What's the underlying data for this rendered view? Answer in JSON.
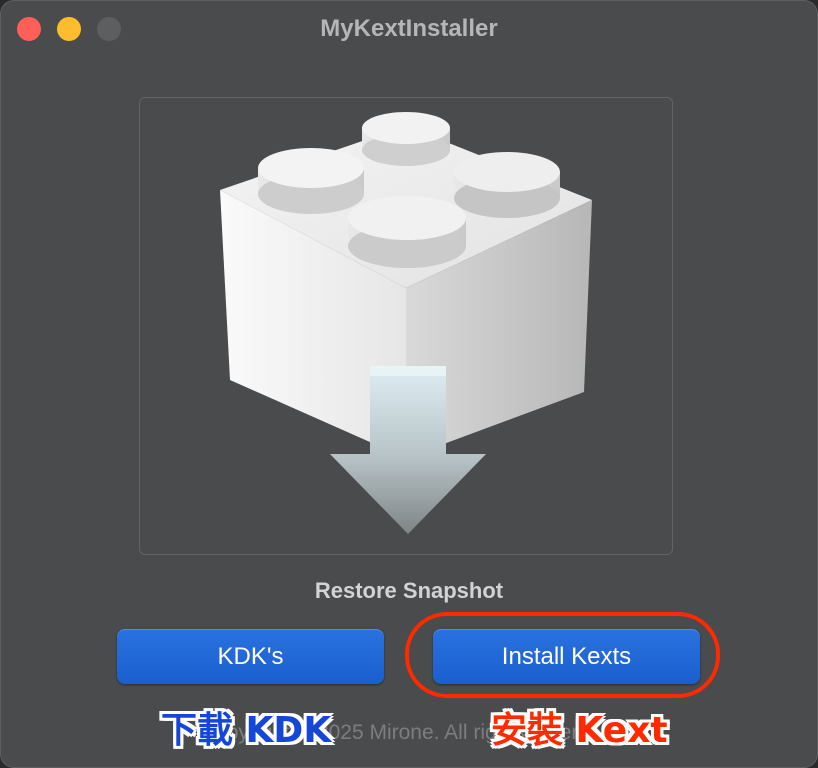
{
  "window": {
    "title": "MyKextInstaller",
    "controls": [
      "close",
      "minimize",
      "zoom"
    ]
  },
  "main": {
    "image_icon": "kext-lego-brick-download-icon",
    "restore_label": "Restore Snapshot",
    "buttons": {
      "kdk_label": "KDK's",
      "install_label": "Install Kexts"
    },
    "copyright": "Copyright © 2025 Mirone. All rights reserved."
  },
  "annotations": {
    "left_text": "下載 KDK",
    "right_text": "安裝 Kext",
    "left_color": "#1546d6",
    "right_color": "#ff2a00"
  },
  "colors": {
    "window_bg": "#4a4b4d",
    "button_blue": "#1a5fcf",
    "close": "#fe5f57",
    "minimize": "#febc2e",
    "zoom_inactive": "#5d5e60"
  }
}
